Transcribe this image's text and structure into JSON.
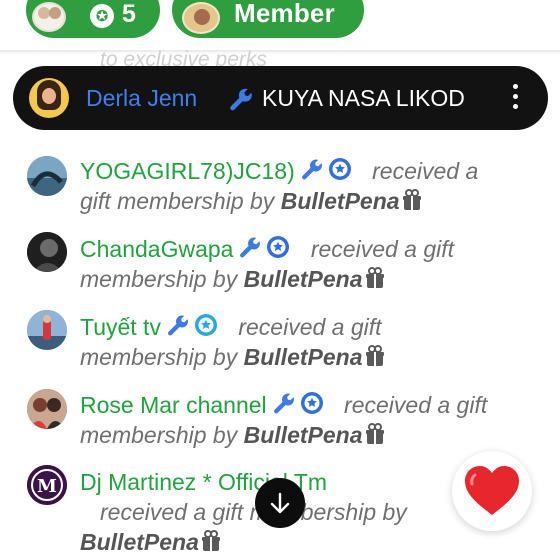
{
  "header": {
    "count_badge": "5",
    "member_label": "Member"
  },
  "ghost_text": "to exclusive perks",
  "pinned": {
    "author": "Derla Jenn",
    "message": "KUYA NASA LIKOD"
  },
  "messages": [
    {
      "author": "YOGAGIRL78)JC18)",
      "line1_text": "received a",
      "line2_text": "gift membership by",
      "gifter": "BulletPena",
      "avatar_color": "#4a6f8a"
    },
    {
      "author": "ChandaGwapa",
      "line1_text": "received a gift",
      "line2_text": "membership by",
      "gifter": "BulletPena",
      "avatar_color": "#2c2c2c"
    },
    {
      "author": "Tuyết tv",
      "line1_text": "received a gift",
      "line2_text": "membership by",
      "gifter": "BulletPena",
      "avatar_color": "#5b7fa8"
    },
    {
      "author": "Rose Mar channel",
      "line1_text": "received a gift",
      "line2_text": "membership by",
      "gifter": "BulletPena",
      "avatar_color": "#a0584a"
    },
    {
      "author": "Dj Martinez * Official Tm",
      "line1_text": "received a gift membership by",
      "line2_text": "",
      "gifter": "BulletPena",
      "avatar_color": "#4b1f5c",
      "avatar_letter": "M"
    }
  ],
  "colors": {
    "brand_green": "#2e9e3e",
    "author_green": "#20a33c",
    "pinned_name_blue": "#3f7ff0",
    "mod_wrench_blue": "#3b7be8",
    "member_badge_blue": "#2f6fe0",
    "heart_red": "#e8262d"
  },
  "icons": {
    "header_badge": "star-badge-icon",
    "mod": "wrench-icon",
    "member": "star-badge-icon",
    "gift": "gift-icon",
    "scroll": "arrow-down-icon",
    "reaction": "heart-icon"
  }
}
